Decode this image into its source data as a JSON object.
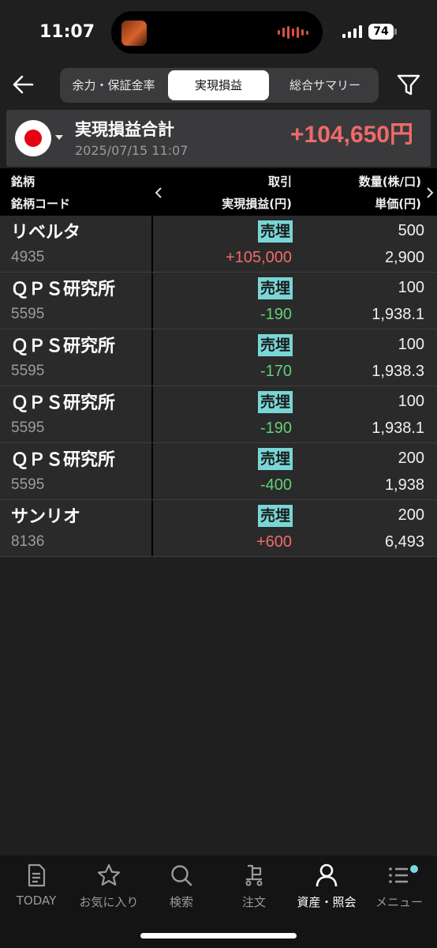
{
  "status_bar": {
    "time": "11:07",
    "battery": "74"
  },
  "header": {
    "tabs": [
      {
        "label": "余力・保証金率"
      },
      {
        "label": "実現損益"
      },
      {
        "label": "総合サマリー"
      }
    ],
    "active_tab": 1
  },
  "summary": {
    "title": "実現損益合計",
    "date": "2025/07/15 11:07",
    "total": "+104,650円"
  },
  "table_header": {
    "col1_row1": "銘柄",
    "col1_row2": "銘柄コード",
    "col2_row1": "取引",
    "col2_row2": "実現損益(円)",
    "col3_row1": "数量(株/口)",
    "col3_row2": "単価(円)"
  },
  "rows": [
    {
      "name": "リベルタ",
      "code": "4935",
      "trade": "売埋",
      "pl": "+105,000",
      "qty": "500",
      "price": "2,900"
    },
    {
      "name": "ＱＰＳ研究所",
      "code": "5595",
      "trade": "売埋",
      "pl": "-190",
      "qty": "100",
      "price": "1,938.1"
    },
    {
      "name": "ＱＰＳ研究所",
      "code": "5595",
      "trade": "売埋",
      "pl": "-170",
      "qty": "100",
      "price": "1,938.3"
    },
    {
      "name": "ＱＰＳ研究所",
      "code": "5595",
      "trade": "売埋",
      "pl": "-190",
      "qty": "100",
      "price": "1,938.1"
    },
    {
      "name": "ＱＰＳ研究所",
      "code": "5595",
      "trade": "売埋",
      "pl": "-400",
      "qty": "200",
      "price": "1,938"
    },
    {
      "name": "サンリオ",
      "code": "8136",
      "trade": "売埋",
      "pl": "+600",
      "qty": "200",
      "price": "6,493"
    }
  ],
  "colors": {
    "positive": "#f06a6a",
    "negative": "#62d07a",
    "trade_badge": "#7ad6d6"
  },
  "bottom_nav": [
    {
      "label": "TODAY",
      "icon": "document-icon"
    },
    {
      "label": "お気に入り",
      "icon": "star-icon"
    },
    {
      "label": "検索",
      "icon": "search-icon"
    },
    {
      "label": "注文",
      "icon": "cart-icon"
    },
    {
      "label": "資産・照会",
      "icon": "person-icon"
    },
    {
      "label": "メニュー",
      "icon": "menu-icon"
    }
  ],
  "active_nav": 4
}
